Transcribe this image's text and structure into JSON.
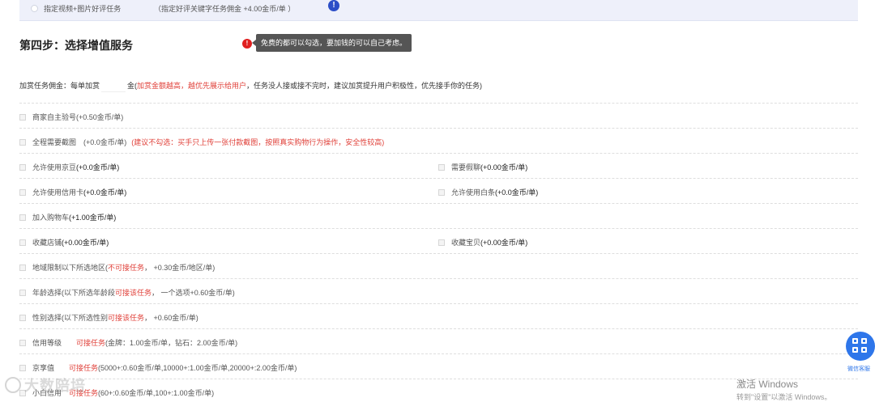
{
  "topbar": {
    "option_label": "指定视频+图片好评任务",
    "option_note": "（指定好评关键字任务佣金 +4.00金币/单 ）",
    "info_icon_label": "!"
  },
  "step": {
    "title": "第四步：选择增值服务",
    "tip_badge": "!",
    "tooltip": "免费的都可以勾选，要加钱的可以自己考虑。"
  },
  "bonus": {
    "label": "加赏任务佣金：每单加赏",
    "unit": "金(",
    "highlight": "加赏金额越高，越优先展示给用户",
    "rest": "，任务没人接或接不完时，建议加赏提升用户积极性，优先接手你的任务)"
  },
  "rows": [
    {
      "left": {
        "label": "商家自主验号",
        "price": "(+0.50金币/单)"
      }
    },
    {
      "left": {
        "label": "全程需要截图",
        "price": "　(+0.0金币/单)",
        "note": "(建议不勾选：买手只上传一张付款截图，按照真实购物行为操作，安全性较高)"
      }
    },
    {
      "left": {
        "label": "允许使用京豆",
        "price": "(+0.0金币/单)"
      },
      "right": {
        "label": "需要假聊",
        "price": "(+0.00金币/单)"
      }
    },
    {
      "left": {
        "label": "允许使用信用卡",
        "price": "(+0.0金币/单)"
      },
      "right": {
        "label": "允许使用白条",
        "price": "(+0.0金币/单)"
      }
    },
    {
      "left": {
        "label": "加入购物车",
        "price": "(+1.00金币/单)"
      }
    },
    {
      "left": {
        "label": "收藏店铺",
        "price": "(+0.00金币/单)"
      },
      "right": {
        "label": "收藏宝贝",
        "price": "(+0.00金币/单)"
      }
    },
    {
      "left": {
        "label": "地域限制以下所选地区(",
        "red": "不可接任务",
        "tail": "， +0.30金币/地区/单)"
      }
    },
    {
      "left": {
        "label": "年龄选择(以下所选年龄段",
        "red": "可接该任务",
        "tail": "， 一个选项+0.60金币/单)"
      }
    },
    {
      "left": {
        "label": "性别选择(以下所选性别",
        "red": "可接该任务",
        "tail": "， +0.60金币/单)"
      }
    },
    {
      "left": {
        "label": "信用等级　　",
        "red": "可接任务",
        "tail": "(金牌：1.00金币/单，钻石：2.00金币/单)"
      }
    },
    {
      "left": {
        "label": "京享值　　",
        "red": "可接任务",
        "tail": "(5000+:0.60金币/单,10000+:1.00金币/单,20000+:2.00金币/单)"
      }
    },
    {
      "left": {
        "label": "小白信用　",
        "red": "可接任务",
        "tail": "(60+:0.60金币/单,100+:1.00金币/单)"
      }
    }
  ],
  "wechat_service": {
    "label": "微信客服",
    "icon": "grid-icon",
    "color": "#2e76ea"
  },
  "overlay": {
    "watermark": "大数陪培",
    "windows_line1": "激活 Windows",
    "windows_line2": "转到\"设置\"以激活 Windows。"
  }
}
